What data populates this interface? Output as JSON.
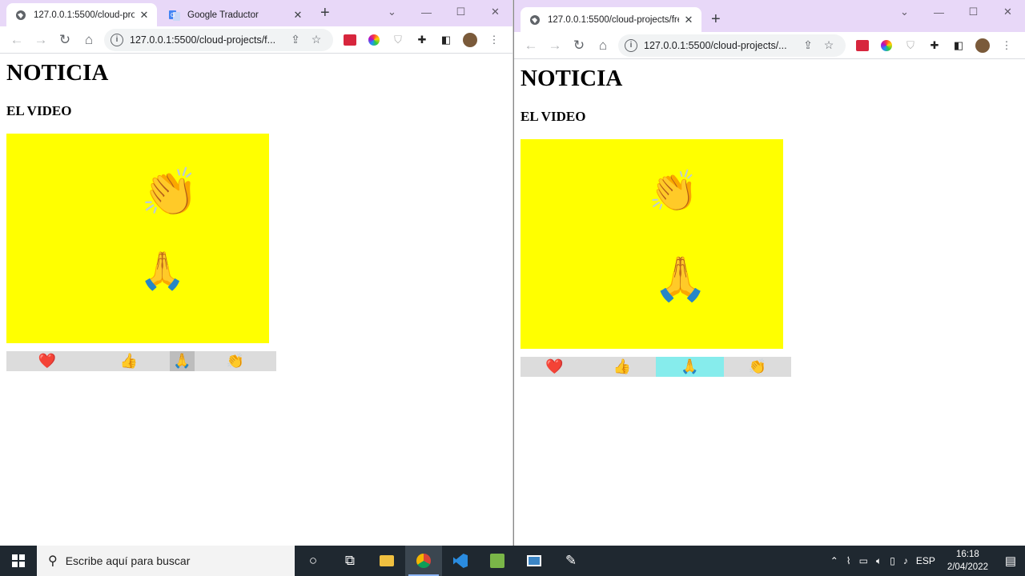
{
  "left_window": {
    "tabs": [
      {
        "title": "127.0.0.1:5500/cloud-proj",
        "icon": "globe-icon",
        "active": true
      },
      {
        "title": "Google Traductor",
        "icon": "google-translate-icon",
        "active": false
      }
    ],
    "url": "127.0.0.1:5500/cloud-projects/f...",
    "page": {
      "heading": "NOTICIA",
      "subheading": "EL VIDEO",
      "stage_color": "#ffff00",
      "stage_emojis": [
        "👏",
        "🙏"
      ],
      "reactions": [
        {
          "emoji": "❤️",
          "name": "heart"
        },
        {
          "emoji": "👍",
          "name": "thumbs-up"
        },
        {
          "emoji": "🙏",
          "name": "pray",
          "selected": true
        },
        {
          "emoji": "👏",
          "name": "clap"
        }
      ]
    }
  },
  "right_window": {
    "tabs": [
      {
        "title": "127.0.0.1:5500/cloud-projects/fre",
        "icon": "globe-icon",
        "active": true
      }
    ],
    "url": "127.0.0.1:5500/cloud-projects/...",
    "page": {
      "heading": "NOTICIA",
      "subheading": "EL VIDEO",
      "stage_color": "#ffff00",
      "stage_emojis": [
        "👏",
        "🙏"
      ],
      "reactions": [
        {
          "emoji": "❤️",
          "name": "heart"
        },
        {
          "emoji": "👍",
          "name": "thumbs-up"
        },
        {
          "emoji": "🙏",
          "name": "pray",
          "selected": true
        },
        {
          "emoji": "👏",
          "name": "clap"
        }
      ]
    }
  },
  "taskbar": {
    "search_placeholder": "Escribe aquí para buscar",
    "language": "ESP",
    "time": "16:18",
    "date": "2/04/2022"
  },
  "colors": {
    "tabstrip": "#e8d8f8",
    "stage": "#ffff00",
    "reaction_bar": "#dcdcdc",
    "selected_left": "#bdbdbd",
    "selected_right": "#86ecec",
    "taskbar": "#1f2830"
  }
}
